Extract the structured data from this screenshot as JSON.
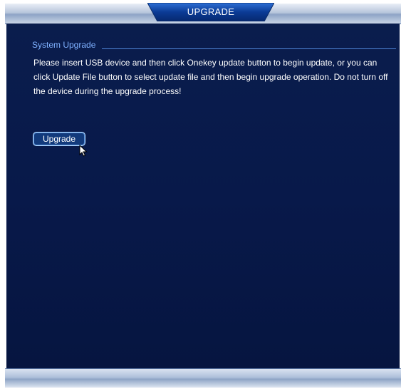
{
  "window": {
    "title": "UPGRADE"
  },
  "section": {
    "title": "System Upgrade",
    "message": "Please insert USB device and then click Onekey update button to begin update, or you can click Update File button to select update file and then begin upgrade operation. Do not turn off the device during the upgrade process!"
  },
  "actions": {
    "upgrade_label": "Upgrade"
  },
  "icons": {
    "cursor": "arrow-cursor-icon"
  },
  "colors": {
    "panel_background": "#08194a",
    "section_title": "#7fb1ff",
    "title_tab": "#0b3b95",
    "text": "#ffffff"
  }
}
